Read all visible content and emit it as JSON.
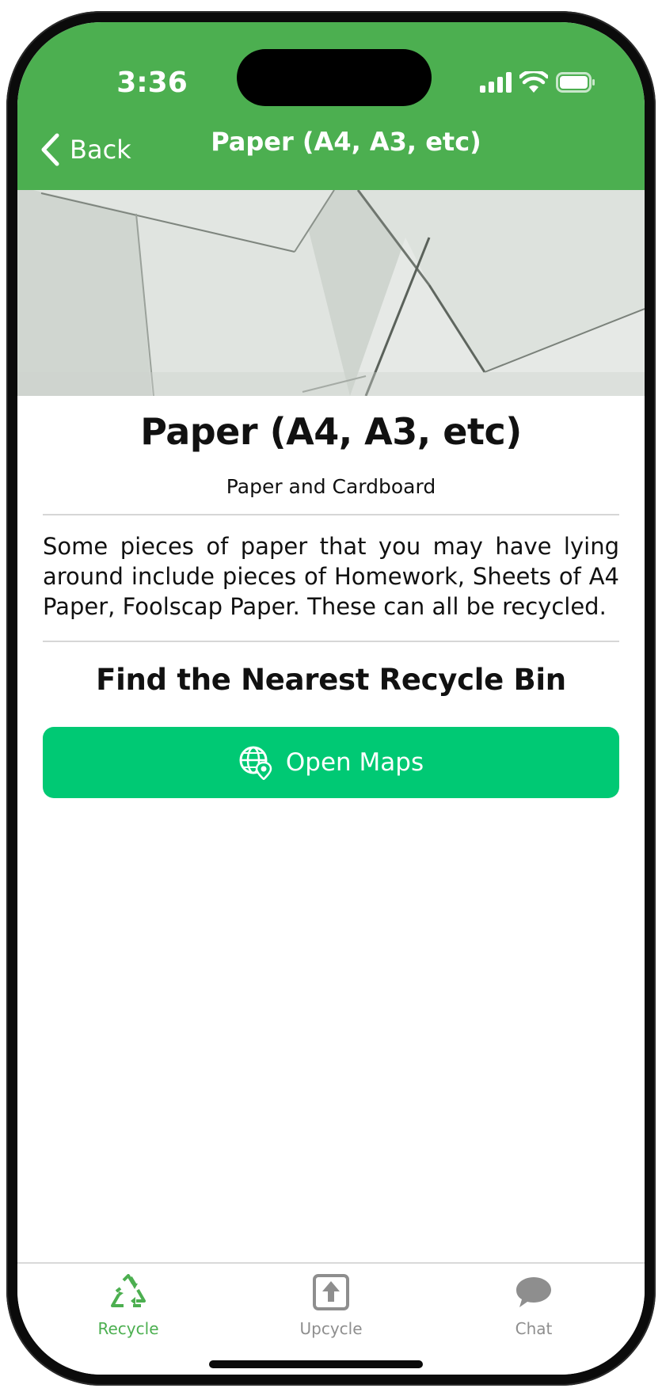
{
  "status_bar": {
    "time": "3:36",
    "icons": [
      "signal-icon",
      "wifi-icon",
      "battery-icon"
    ]
  },
  "nav": {
    "back_label": "Back",
    "title": "Paper (A4, A3, etc)"
  },
  "item": {
    "title": "Paper (A4, A3, etc)",
    "category": "Paper and Cardboard",
    "description": "Some pieces of paper that you may have lying around include pieces of Homework, Sheets of A4 Paper, Foolscap Paper. These can all be recycled."
  },
  "find_bin": {
    "title": "Find the Nearest Recycle Bin",
    "button_label": "Open Maps",
    "button_icon": "globe-location-icon"
  },
  "tabs": [
    {
      "label": "Recycle",
      "icon": "recycle-icon",
      "active": true
    },
    {
      "label": "Upcycle",
      "icon": "upload-box-icon",
      "active": false
    },
    {
      "label": "Chat",
      "icon": "chat-bubble-icon",
      "active": false
    }
  ],
  "colors": {
    "header": "#4caf50",
    "button": "#00c974",
    "tab_active": "#4caf50",
    "tab_inactive": "#8e8e8e"
  }
}
